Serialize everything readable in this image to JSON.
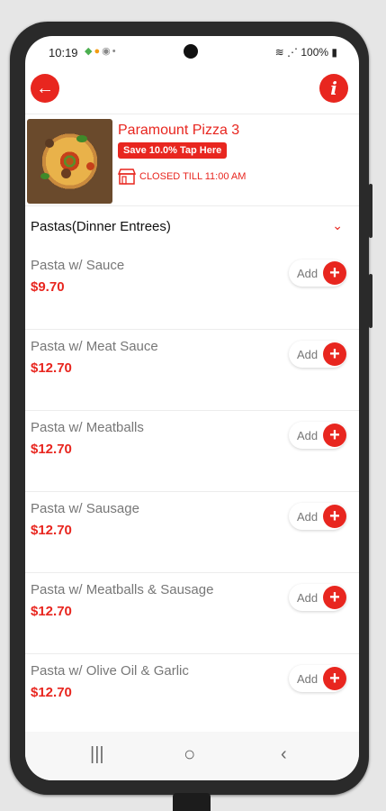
{
  "status_bar": {
    "time": "10:19",
    "battery": "100%"
  },
  "header": {
    "back_icon": "arrow-left-icon",
    "info_icon": "info-icon"
  },
  "restaurant": {
    "name": "Paramount Pizza 3",
    "save_prefix": "Save ",
    "save_bold": "10.0% Tap Here",
    "status": "CLOSED TILL 11:00 AM"
  },
  "section": {
    "title": "Pastas(Dinner Entrees)"
  },
  "items": [
    {
      "name": "Pasta w/ Sauce",
      "price": "$9.70",
      "add_label": "Add"
    },
    {
      "name": "Pasta w/ Meat Sauce",
      "price": "$12.70",
      "add_label": "Add"
    },
    {
      "name": "Pasta w/ Meatballs",
      "price": "$12.70",
      "add_label": "Add"
    },
    {
      "name": "Pasta w/ Sausage",
      "price": "$12.70",
      "add_label": "Add"
    },
    {
      "name": "Pasta w/ Meatballs & Sausage",
      "price": "$12.70",
      "add_label": "Add"
    },
    {
      "name": "Pasta w/ Olive Oil & Garlic",
      "price": "$12.70",
      "add_label": "Add"
    }
  ],
  "colors": {
    "accent": "#e8261f"
  }
}
